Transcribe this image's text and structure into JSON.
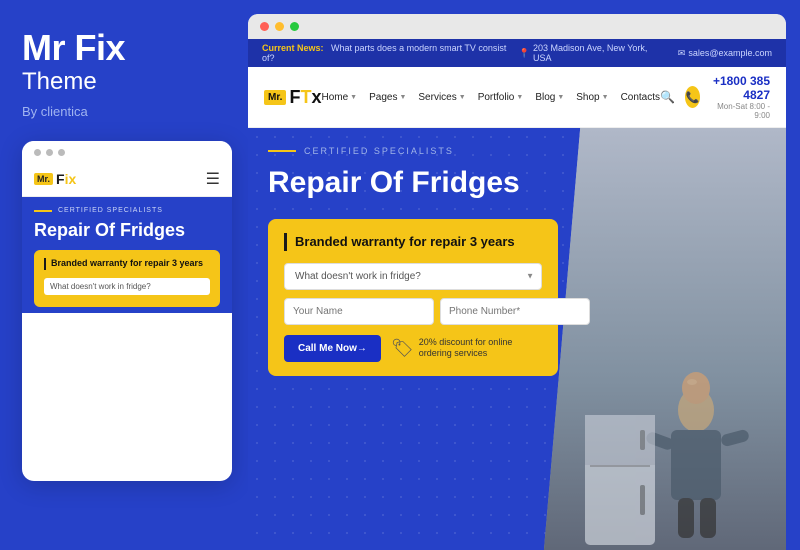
{
  "left": {
    "title": "Mr Fix",
    "subtitle": "Theme",
    "by": "By clientica",
    "dots": [
      "gray",
      "gray",
      "gray"
    ],
    "mobile_logo_mr": "Mr.",
    "mobile_logo_fix": "F",
    "mobile_logo_fix_highlight": "x",
    "mobile_certified_text": "CERTIFIED SPECIALISTS",
    "mobile_heading": "Repair Of Fridges",
    "mobile_warranty_title": "Branded warranty for repair 3 years",
    "mobile_select_placeholder": "What doesn't work in fridge?"
  },
  "right": {
    "browser_dots": [
      "red",
      "yellow",
      "green"
    ],
    "news_bar": {
      "label": "Current News:",
      "text": "What parts does a modern smart TV consist of?",
      "location_icon": "📍",
      "location": "203 Madison Ave, New York, USA",
      "email_icon": "✉",
      "email": "sales@example.com"
    },
    "nav": {
      "logo_mr": "Mr.",
      "logo_text": "FTx",
      "logo_highlight": "T",
      "links": [
        {
          "label": "Home",
          "has_dropdown": true
        },
        {
          "label": "Pages",
          "has_dropdown": true
        },
        {
          "label": "Services",
          "has_dropdown": true
        },
        {
          "label": "Portfolio",
          "has_dropdown": true
        },
        {
          "label": "Blog",
          "has_dropdown": true
        },
        {
          "label": "Shop",
          "has_dropdown": true
        },
        {
          "label": "Contacts",
          "has_dropdown": false
        }
      ],
      "phone": "+1800 385 4827",
      "hours": "Mon-Sat 8:00 - 9:00"
    },
    "hero": {
      "certified_text": "CERTIFIED SPECIALISTS",
      "title": "Repair Of Fridges",
      "card": {
        "warranty_title": "Branded warranty for repair 3 years",
        "select_placeholder": "What doesn't work in fridge?",
        "name_placeholder": "Your Name",
        "phone_placeholder": "Phone Number*",
        "btn_label": "Call Me Now→",
        "discount_text": "20% discount for online ordering services"
      }
    }
  }
}
